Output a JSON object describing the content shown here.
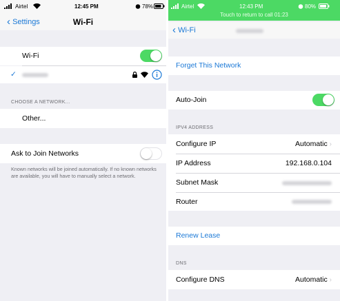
{
  "left_screen": {
    "status_bar": {
      "carrier": "Airtel",
      "time": "12:45 PM",
      "battery": "78%"
    },
    "nav": {
      "back_label": "Settings",
      "title": "Wi-Fi"
    },
    "wifi_row": {
      "label": "Wi-Fi",
      "on": true
    },
    "connected_network": {
      "checkmark": "✓"
    },
    "choose_header": "CHOOSE A NETWORK...",
    "other_row": "Other...",
    "ask_row": {
      "label": "Ask to Join Networks",
      "on": false
    },
    "ask_footer": "Known networks will be joined automatically. If no known networks are available, you will have to manually select a network.",
    "colors": {
      "accent": "#1a78d6",
      "toggle_on": "#4cd964",
      "background": "#efeff4"
    }
  },
  "right_screen": {
    "status_bar": {
      "carrier": "Airtel",
      "time": "12:43 PM",
      "battery": "80%",
      "call_banner": "Touch to return to call 01:23"
    },
    "nav": {
      "back_label": "Wi-Fi"
    },
    "forget_label": "Forget This Network",
    "auto_join": {
      "label": "Auto-Join",
      "on": true
    },
    "ipv4_header": "IPV4 ADDRESS",
    "configure_ip": {
      "label": "Configure IP",
      "value": "Automatic"
    },
    "ip_address": {
      "label": "IP Address",
      "value": "192.168.0.104"
    },
    "subnet_label": "Subnet Mask",
    "router_label": "Router",
    "renew_label": "Renew Lease",
    "dns_header": "DNS",
    "configure_dns": {
      "label": "Configure DNS",
      "value": "Automatic"
    },
    "colors": {
      "accent": "#1a78d6",
      "call_green": "#4cd964"
    }
  }
}
